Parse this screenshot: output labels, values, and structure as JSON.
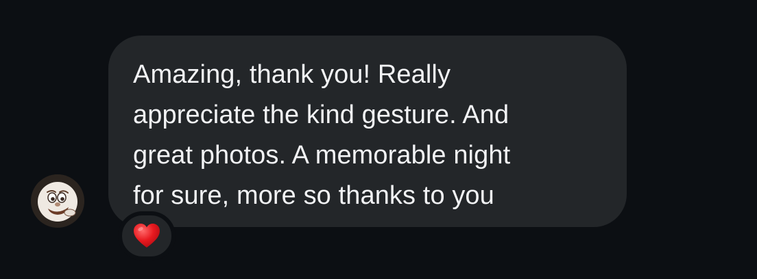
{
  "conversation": {
    "message": {
      "text": "Amazing, thank you! Really\nappreciate the kind gesture. And\ngreat photos. A memorable night\nfor sure, more so thanks to you",
      "sender_avatar_icon": "face-avatar",
      "reaction": {
        "icon": "red-heart-icon",
        "color": "#e8191f"
      }
    },
    "colors": {
      "background": "#0c0f13",
      "bubble": "#232629",
      "text": "#f2f3f5"
    }
  }
}
